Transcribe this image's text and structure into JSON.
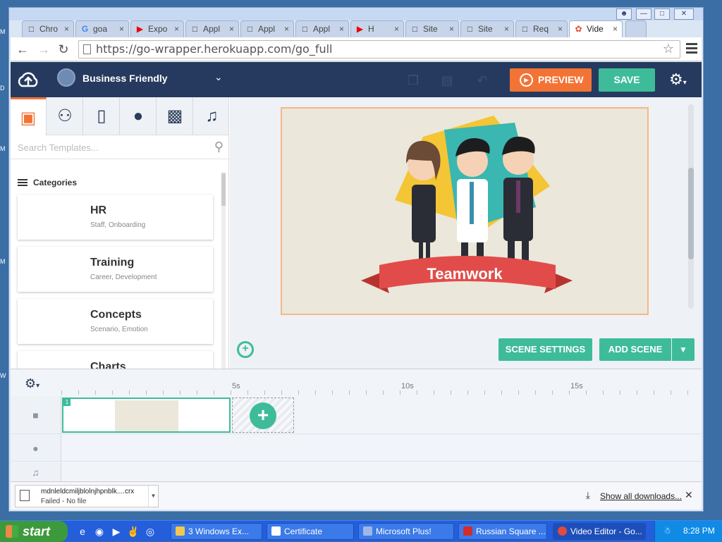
{
  "browser": {
    "tabs": [
      {
        "title": "Chro",
        "icon": "page-icon"
      },
      {
        "title": "goa",
        "icon": "google-icon"
      },
      {
        "title": "Expo",
        "icon": "youtube-icon"
      },
      {
        "title": "Appl",
        "icon": "page-icon"
      },
      {
        "title": "Appl",
        "icon": "page-icon"
      },
      {
        "title": "Appl",
        "icon": "page-icon"
      },
      {
        "title": "H",
        "icon": "youtube-icon"
      },
      {
        "title": "Site",
        "icon": "page-icon"
      },
      {
        "title": "Site",
        "icon": "page-icon"
      },
      {
        "title": "Req",
        "icon": "page-icon"
      },
      {
        "title": "Vide",
        "icon": "app-icon"
      }
    ],
    "url": "https://go-wrapper.herokuapp.com/go_full"
  },
  "app": {
    "theme_name": "Business Friendly",
    "preview_label": "PREVIEW",
    "save_label": "SAVE",
    "search_placeholder": "Search Templates...",
    "categories_label": "Categories",
    "template_categories": [
      {
        "title": "HR",
        "subtitle": "Staff, Onboarding"
      },
      {
        "title": "Training",
        "subtitle": "Career, Development"
      },
      {
        "title": "Concepts",
        "subtitle": "Scenario, Emotion"
      },
      {
        "title": "Charts",
        "subtitle": ""
      }
    ],
    "canvas_title": "Teamwork",
    "scene_settings_label": "SCENE SETTINGS",
    "add_scene_label": "ADD SCENE",
    "timeline": {
      "markers": [
        "5s",
        "10s",
        "15s"
      ],
      "scene_number": "1"
    }
  },
  "downloads": {
    "file_name": "mdnleldcmiljblolnjhpnblk....crx",
    "status": "Failed - No file",
    "show_all_label": "Show all downloads..."
  },
  "taskbar": {
    "start_label": "start",
    "tasks": [
      {
        "label": "3 Windows Ex...",
        "color": "#f2c94c"
      },
      {
        "label": "Certificate",
        "color": "#ffffff"
      },
      {
        "label": "Microsoft Plus!",
        "color": "#9fb7e8"
      },
      {
        "label": "Russian Square ...",
        "color": "#d42b2b"
      },
      {
        "label": "Video Editor - Go...",
        "color": "#e04a3f"
      }
    ],
    "clock": "8:28 PM"
  }
}
